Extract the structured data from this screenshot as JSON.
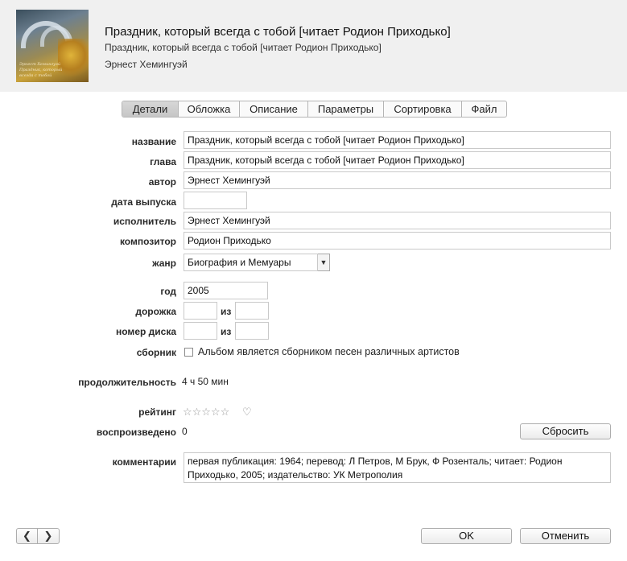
{
  "header": {
    "title": "Праздник, который всегда с тобой [читает Родион Приходько]",
    "subtitle": "Праздник, который всегда с тобой [читает Родион Приходько]",
    "author": "Эрнест Хемингуэй",
    "cover_caption_1": "Эрнест Хемингуэй",
    "cover_caption_2": "Праздник, который всегда с тобой"
  },
  "tabs": [
    {
      "label": "Детали",
      "active": true
    },
    {
      "label": "Обложка",
      "active": false
    },
    {
      "label": "Описание",
      "active": false
    },
    {
      "label": "Параметры",
      "active": false
    },
    {
      "label": "Сортировка",
      "active": false
    },
    {
      "label": "Файл",
      "active": false
    }
  ],
  "form": {
    "name_label": "название",
    "name_value": "Праздник, который всегда с тобой [читает Родион Приходько]",
    "chapter_label": "глава",
    "chapter_value": "Праздник, который всегда с тобой [читает Родион Приходько]",
    "author_label": "автор",
    "author_value": "Эрнест Хемингуэй",
    "release_label": "дата выпуска",
    "release_value": "",
    "performer_label": "исполнитель",
    "performer_value": "Эрнест Хемингуэй",
    "composer_label": "композитор",
    "composer_value": "Родион Приходько",
    "genre_label": "жанр",
    "genre_value": "Биография и Мемуары",
    "year_label": "год",
    "year_value": "2005",
    "track_label": "дорожка",
    "track_value": "",
    "track_of_label": "из",
    "track_of_value": "",
    "disc_label": "номер диска",
    "disc_value": "",
    "disc_of_label": "из",
    "disc_of_value": "",
    "compilation_label": "сборник",
    "compilation_text": "Альбом является сборником песен различных артистов",
    "compilation_checked": false,
    "duration_label": "продолжительность",
    "duration_value": "4 ч 50 мин",
    "rating_label": "рейтинг",
    "rating_stars": "☆☆☆☆☆",
    "rating_value": 0,
    "plays_label": "воспроизведено",
    "plays_value": "0",
    "reset_label": "Сбросить",
    "comments_label": "комментарии",
    "comments_value": "первая публикация: 1964; перевод: Л Петров, М Брук, Ф Розенталь; читает: Родион Приходько, 2005; издательство: УК Метрополия"
  },
  "footer": {
    "prev_icon": "chevron-left-icon",
    "next_icon": "chevron-right-icon",
    "ok_label": "OK",
    "cancel_label": "Отменить"
  }
}
